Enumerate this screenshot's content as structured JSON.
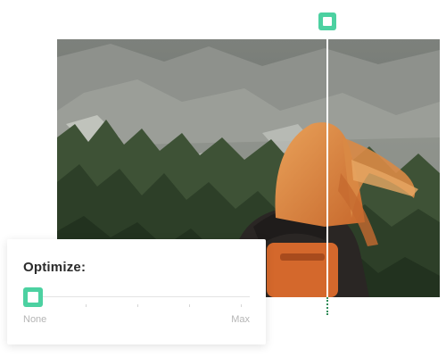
{
  "optimize": {
    "title": "Optimize:",
    "min_label": "None",
    "max_label": "Max",
    "value": 0
  },
  "compare": {
    "handle_color": "#4cd1a1"
  },
  "colors": {
    "accent": "#4cd1a1",
    "track": "#e3e3e3",
    "muted_text": "#b5b5b5",
    "title_text": "#2b2b2b"
  }
}
